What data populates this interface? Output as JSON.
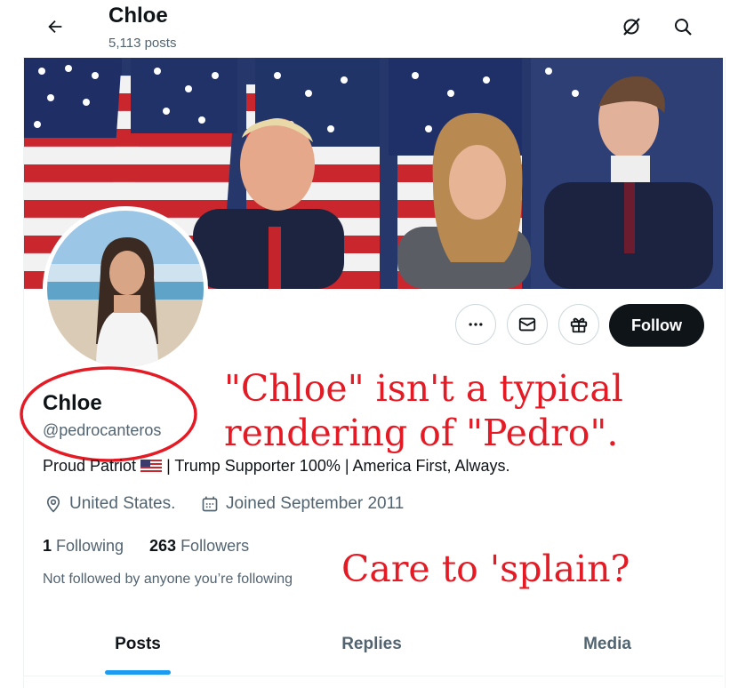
{
  "header": {
    "title": "Chloe",
    "post_count": "5,113 posts",
    "back_icon": "arrow-left-icon",
    "right_icons": [
      "no-grok-icon",
      "search-icon"
    ]
  },
  "profile": {
    "name": "Chloe",
    "handle": "@pedrocanteros",
    "bio_before_flag": "Proud Patriot",
    "bio_after_flag": "| Trump Supporter 100% | America First, Always.",
    "location": "United States.",
    "joined": "Joined September 2011",
    "following_count": "1",
    "following_label": "Following",
    "followers_count": "263",
    "followers_label": "Followers",
    "not_followed": "Not followed by anyone you’re following"
  },
  "actions": {
    "more_icon": "more-icon",
    "message_icon": "envelope-icon",
    "gift_icon": "gift-icon",
    "follow_label": "Follow"
  },
  "annotations": {
    "line1": "\"Chloe\" isn't a typical",
    "line2": "rendering of \"Pedro\".",
    "line3": "Care to 'splain?"
  },
  "tabs": [
    {
      "label": "Posts",
      "active": true
    },
    {
      "label": "Replies",
      "active": false
    },
    {
      "label": "Media",
      "active": false
    }
  ],
  "colors": {
    "accent": "#1d9bf0",
    "annotation_red": "#e41b25",
    "follow_button": "#0f1419"
  }
}
